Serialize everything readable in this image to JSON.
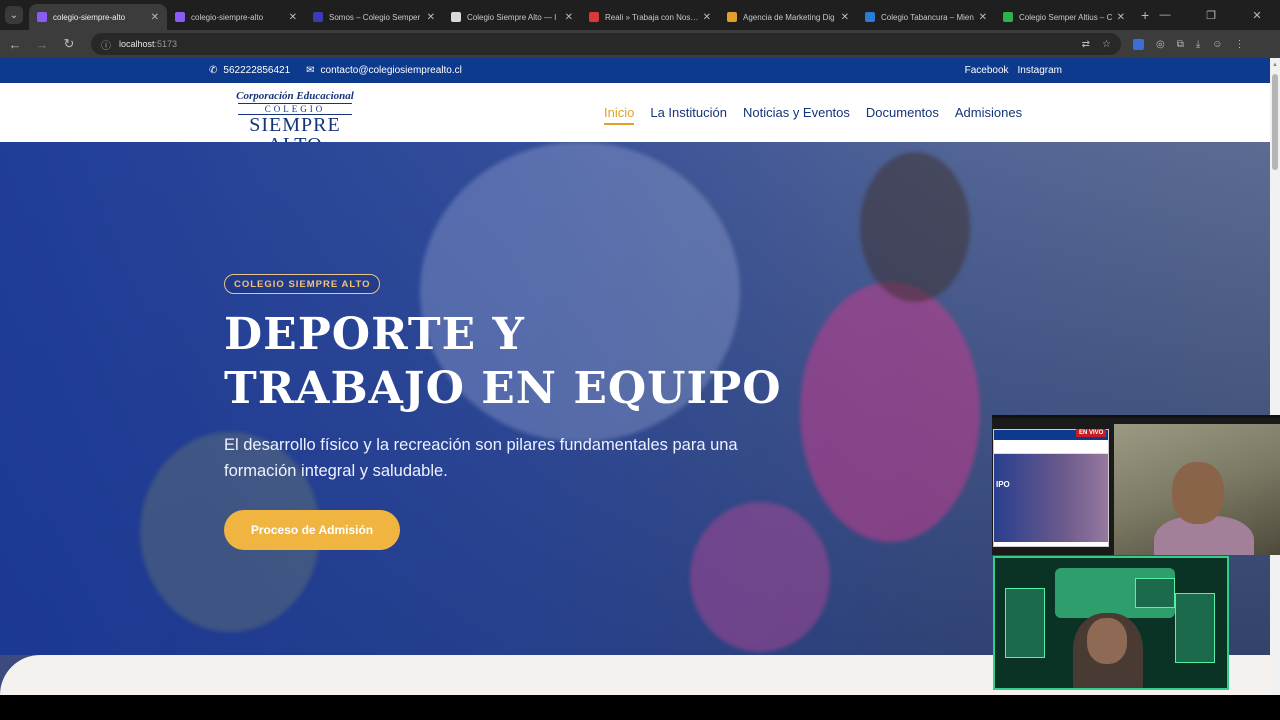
{
  "browser": {
    "tabs": [
      {
        "title": "colegio-siempre-alto",
        "active": true,
        "favicon_color": "#8a5cf6"
      },
      {
        "title": "colegio-siempre-alto",
        "active": false,
        "favicon_color": "#8a5cf6"
      },
      {
        "title": "Somos – Colegio Semper",
        "active": false,
        "favicon_color": "#3b3bb8"
      },
      {
        "title": "Colegio Siempre Alto — I",
        "active": false,
        "favicon_color": "#d9d9d9"
      },
      {
        "title": "Reali » Trabaja con Nosotr",
        "active": false,
        "favicon_color": "#d83a3a"
      },
      {
        "title": "Agencia de Marketing Dig",
        "active": false,
        "favicon_color": "#e0a12b"
      },
      {
        "title": "Colegio Tabancura – Mien",
        "active": false,
        "favicon_color": "#2b7bd8"
      },
      {
        "title": "Colegio Semper Altius – C",
        "active": false,
        "favicon_color": "#2fb24a"
      }
    ],
    "url_host": "localhost",
    "url_port": ":5173"
  },
  "topbar": {
    "phone": "562222856421",
    "email": "contacto@colegiosiemprealto.cl",
    "social": [
      "Facebook",
      "Instagram"
    ]
  },
  "logo": {
    "line1": "Corporación Educacional",
    "line2": "COLEGIO",
    "line3": "SIEMPRE ALTO"
  },
  "nav": {
    "items": [
      "Inicio",
      "La Institución",
      "Noticias y Eventos",
      "Documentos",
      "Admisiones"
    ],
    "active": "Inicio"
  },
  "hero": {
    "badge": "COLEGIO SIEMPRE ALTO",
    "title_line1": "DEPORTE Y",
    "title_line2": "TRABAJO EN EQUIPO",
    "subtitle": "El desarrollo físico y la recreación son pilares fundamentales para una formación integral y saludable.",
    "cta": "Proceso de Admisión"
  },
  "overlay": {
    "live_label": "EN VIVO",
    "mini_text": "IPO"
  },
  "colors": {
    "brand_blue": "#0d3a8c",
    "accent_gold": "#f0b541"
  }
}
